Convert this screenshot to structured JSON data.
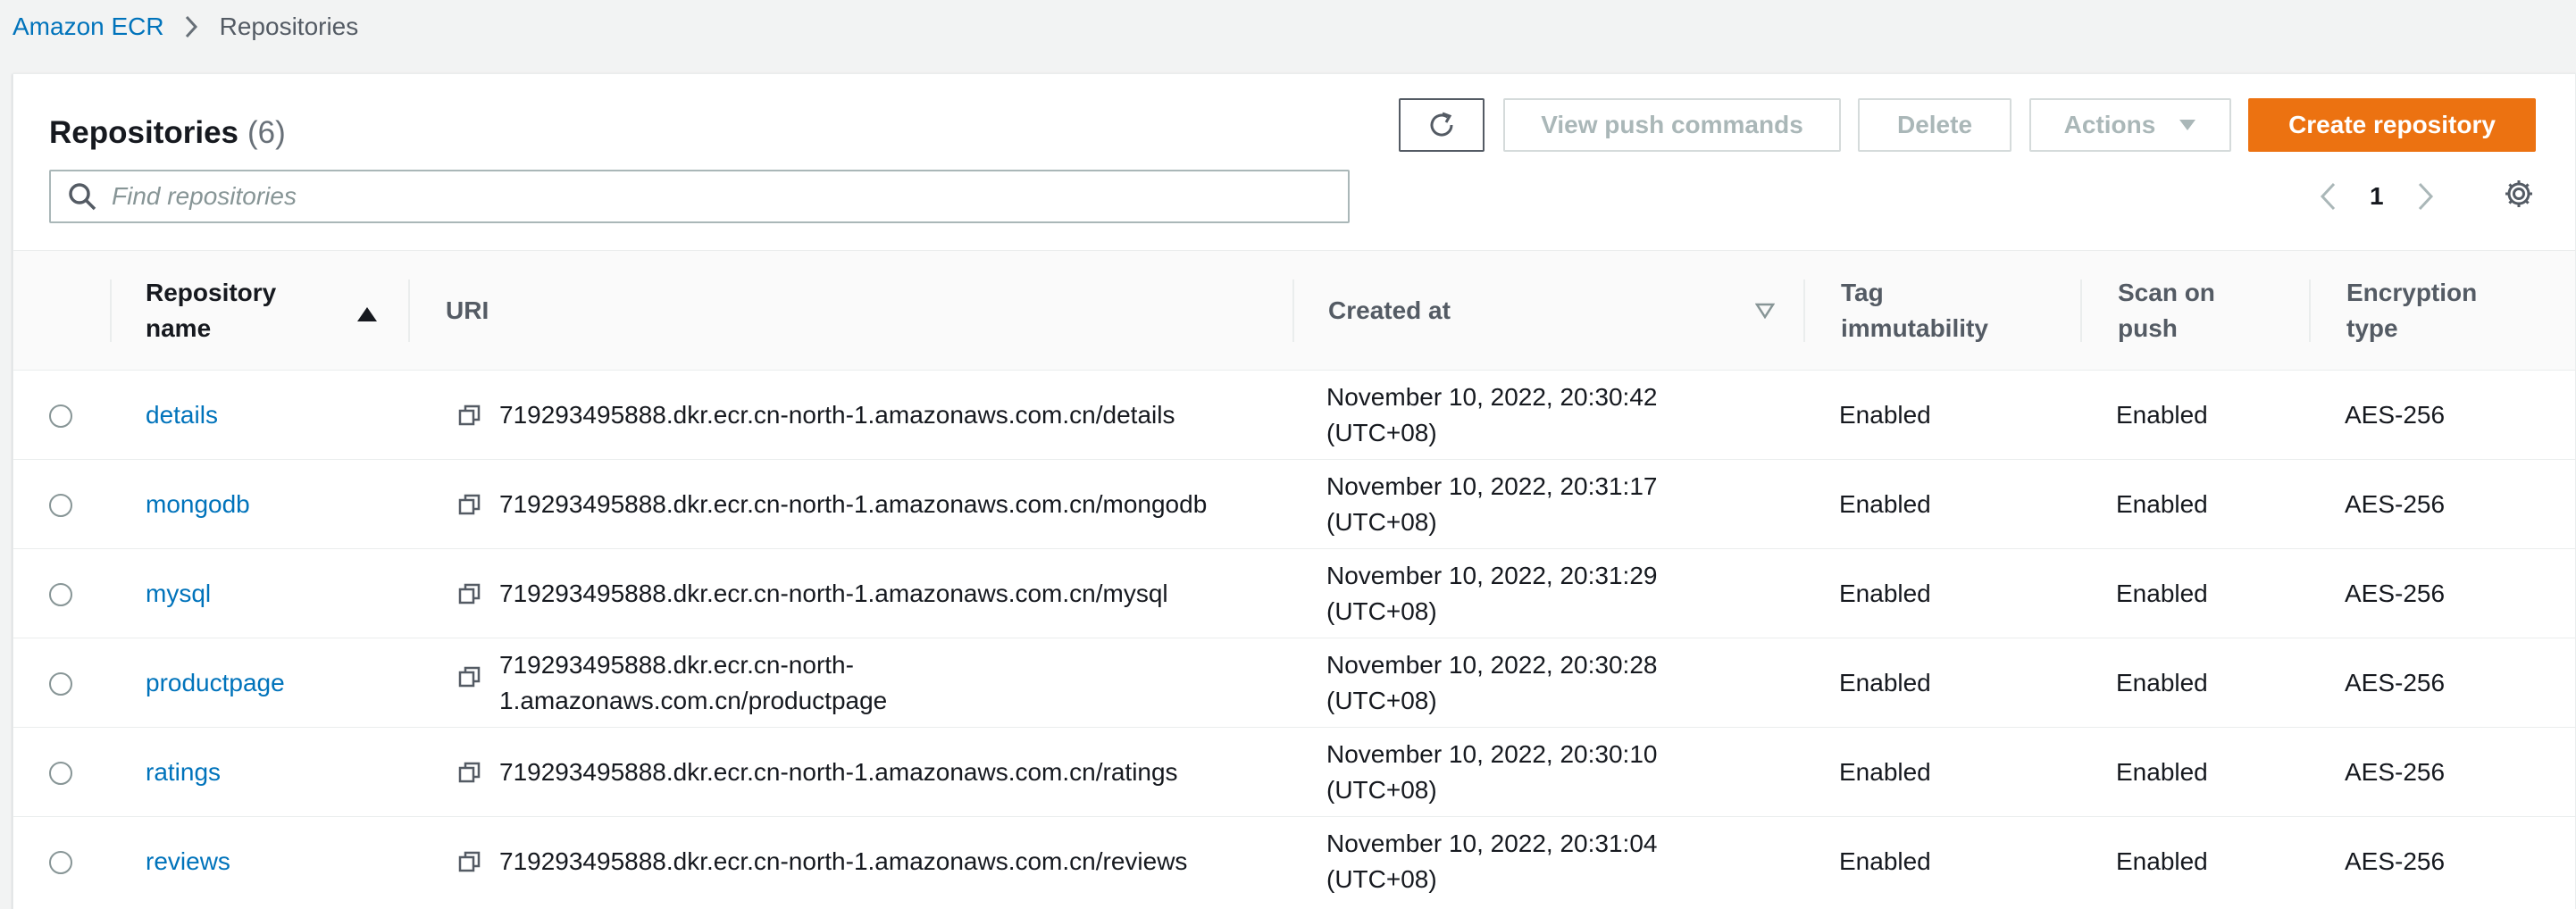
{
  "breadcrumb": {
    "root": "Amazon ECR",
    "current": "Repositories"
  },
  "panel": {
    "title": "Repositories",
    "count": "(6)"
  },
  "toolbar": {
    "push_label": "View push commands",
    "delete_label": "Delete",
    "actions_label": "Actions",
    "create_label": "Create repository"
  },
  "search": {
    "placeholder": "Find repositories",
    "value": ""
  },
  "pagination": {
    "current_page": "1"
  },
  "table": {
    "columns": {
      "repo_name_line1": "Repository",
      "repo_name_line2": "name",
      "uri": "URI",
      "created": "Created at",
      "tag_line1": "Tag",
      "tag_line2": "immutability",
      "scan_line1": "Scan on",
      "scan_line2": "push",
      "enc_line1": "Encryption",
      "enc_line2": "type"
    },
    "rows": [
      {
        "name": "details",
        "uri_line1": "719293495888.dkr.ecr.cn-north-1.amazonaws.com.cn/details",
        "uri_line2": "",
        "created_line1": "November 10, 2022, 20:30:42",
        "created_line2": "(UTC+08)",
        "tag": "Enabled",
        "scan": "Enabled",
        "enc": "AES-256"
      },
      {
        "name": "mongodb",
        "uri_line1": "719293495888.dkr.ecr.cn-north-1.amazonaws.com.cn/mongodb",
        "uri_line2": "",
        "created_line1": "November 10, 2022, 20:31:17",
        "created_line2": "(UTC+08)",
        "tag": "Enabled",
        "scan": "Enabled",
        "enc": "AES-256"
      },
      {
        "name": "mysql",
        "uri_line1": "719293495888.dkr.ecr.cn-north-1.amazonaws.com.cn/mysql",
        "uri_line2": "",
        "created_line1": "November 10, 2022, 20:31:29",
        "created_line2": "(UTC+08)",
        "tag": "Enabled",
        "scan": "Enabled",
        "enc": "AES-256"
      },
      {
        "name": "productpage",
        "uri_line1": "719293495888.dkr.ecr.cn-north-",
        "uri_line2": "1.amazonaws.com.cn/productpage",
        "created_line1": "November 10, 2022, 20:30:28",
        "created_line2": "(UTC+08)",
        "tag": "Enabled",
        "scan": "Enabled",
        "enc": "AES-256"
      },
      {
        "name": "ratings",
        "uri_line1": "719293495888.dkr.ecr.cn-north-1.amazonaws.com.cn/ratings",
        "uri_line2": "",
        "created_line1": "November 10, 2022, 20:30:10",
        "created_line2": "(UTC+08)",
        "tag": "Enabled",
        "scan": "Enabled",
        "enc": "AES-256"
      },
      {
        "name": "reviews",
        "uri_line1": "719293495888.dkr.ecr.cn-north-1.amazonaws.com.cn/reviews",
        "uri_line2": "",
        "created_line1": "November 10, 2022, 20:31:04",
        "created_line2": "(UTC+08)",
        "tag": "Enabled",
        "scan": "Enabled",
        "enc": "AES-256"
      }
    ]
  },
  "icons": {
    "refresh": "refresh-icon",
    "search": "search-icon",
    "settings": "gear-icon",
    "copy": "copy-icon",
    "breadcrumb_sep": "chevron-right-icon"
  },
  "colors": {
    "link": "#0073bb",
    "primary_button": "#ec7211",
    "disabled_text": "#aab7b8"
  }
}
